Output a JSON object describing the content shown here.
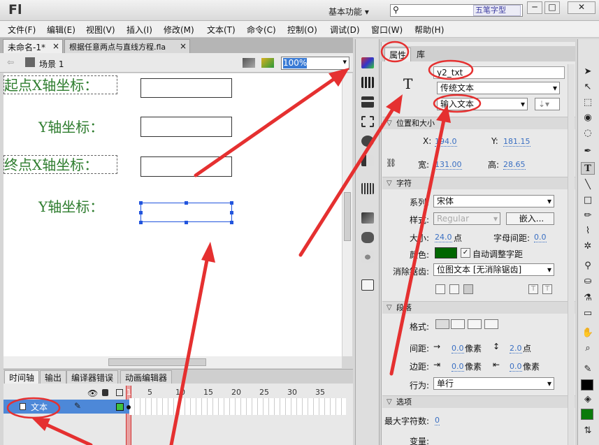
{
  "app": {
    "logo": "Fl",
    "workspace": "基本功能",
    "watermark": "五笔字型"
  },
  "window_buttons": [
    "─",
    "□",
    "✕"
  ],
  "menu": [
    "文件(F)",
    "编辑(E)",
    "视图(V)",
    "插入(I)",
    "修改(M)",
    "文本(T)",
    "命令(C)",
    "控制(O)",
    "调试(D)",
    "窗口(W)",
    "帮助(H)"
  ],
  "doc_tabs": [
    {
      "label": "未命名-1*",
      "close": "×"
    },
    {
      "label": "根据任意两点与直线方程.fla",
      "close": "×"
    }
  ],
  "scene": {
    "label": "场景 1",
    "zoom": "100%"
  },
  "stage": {
    "label_start_x": "起点X轴坐标：",
    "label_start_y": "Y轴坐标：",
    "label_end_x": "终点X轴坐标：",
    "label_end_y": "Y轴坐标："
  },
  "timeline": {
    "tabs": [
      "时间轴",
      "输出",
      "编译器错误",
      "动画编辑器"
    ],
    "frame_numbers": [
      "1",
      "5",
      "10",
      "15",
      "20",
      "25",
      "30",
      "35"
    ],
    "layer_name": "文本"
  },
  "properties": {
    "tabs": [
      "属性",
      "库"
    ],
    "type_icon": "T",
    "instance_name": "y2_txt",
    "text_engine": "传统文本",
    "text_type": "输入文本",
    "sections": {
      "position": "位置和大小",
      "character": "字符",
      "paragraph": "段落",
      "options": "选项"
    },
    "x_label": "X:",
    "x_value": "194.0",
    "y_label": "Y:",
    "y_value": "181.15",
    "width_label": "宽:",
    "width_value": "131.00",
    "height_label": "高:",
    "height_value": "28.65",
    "family_label": "系列:",
    "family_value": "宋体",
    "style_label": "样式:",
    "style_value": "Regular",
    "embed_button": "嵌入...",
    "size_label": "大小:",
    "size_value": "24.0",
    "size_unit": "点",
    "spacing_label": "字母间距:",
    "spacing_value": "0.0",
    "color_label": "颜色:",
    "color_value": "#006600",
    "auto_kern": "自动调整字距",
    "antialias_label": "消除锯齿:",
    "antialias_value": "位图文本 [无消除锯齿]",
    "format_label": "格式:",
    "gap_label": "间距:",
    "indent_value": "0.0",
    "pixel_unit": "像素",
    "line_spacing_value": "2.0",
    "point_unit": "点",
    "margin_label": "边距:",
    "margin_left_value": "0.0",
    "margin_right_value": "0.0",
    "behavior_label": "行为:",
    "behavior_value": "单行",
    "max_chars_label": "最大字符数:",
    "max_chars_value": "0",
    "variable_label": "变量:"
  },
  "colors": {
    "accent": "#3a7bd5",
    "annotation": "#e53030",
    "label_green": "#2f7d2f",
    "text_color": "#006600"
  }
}
